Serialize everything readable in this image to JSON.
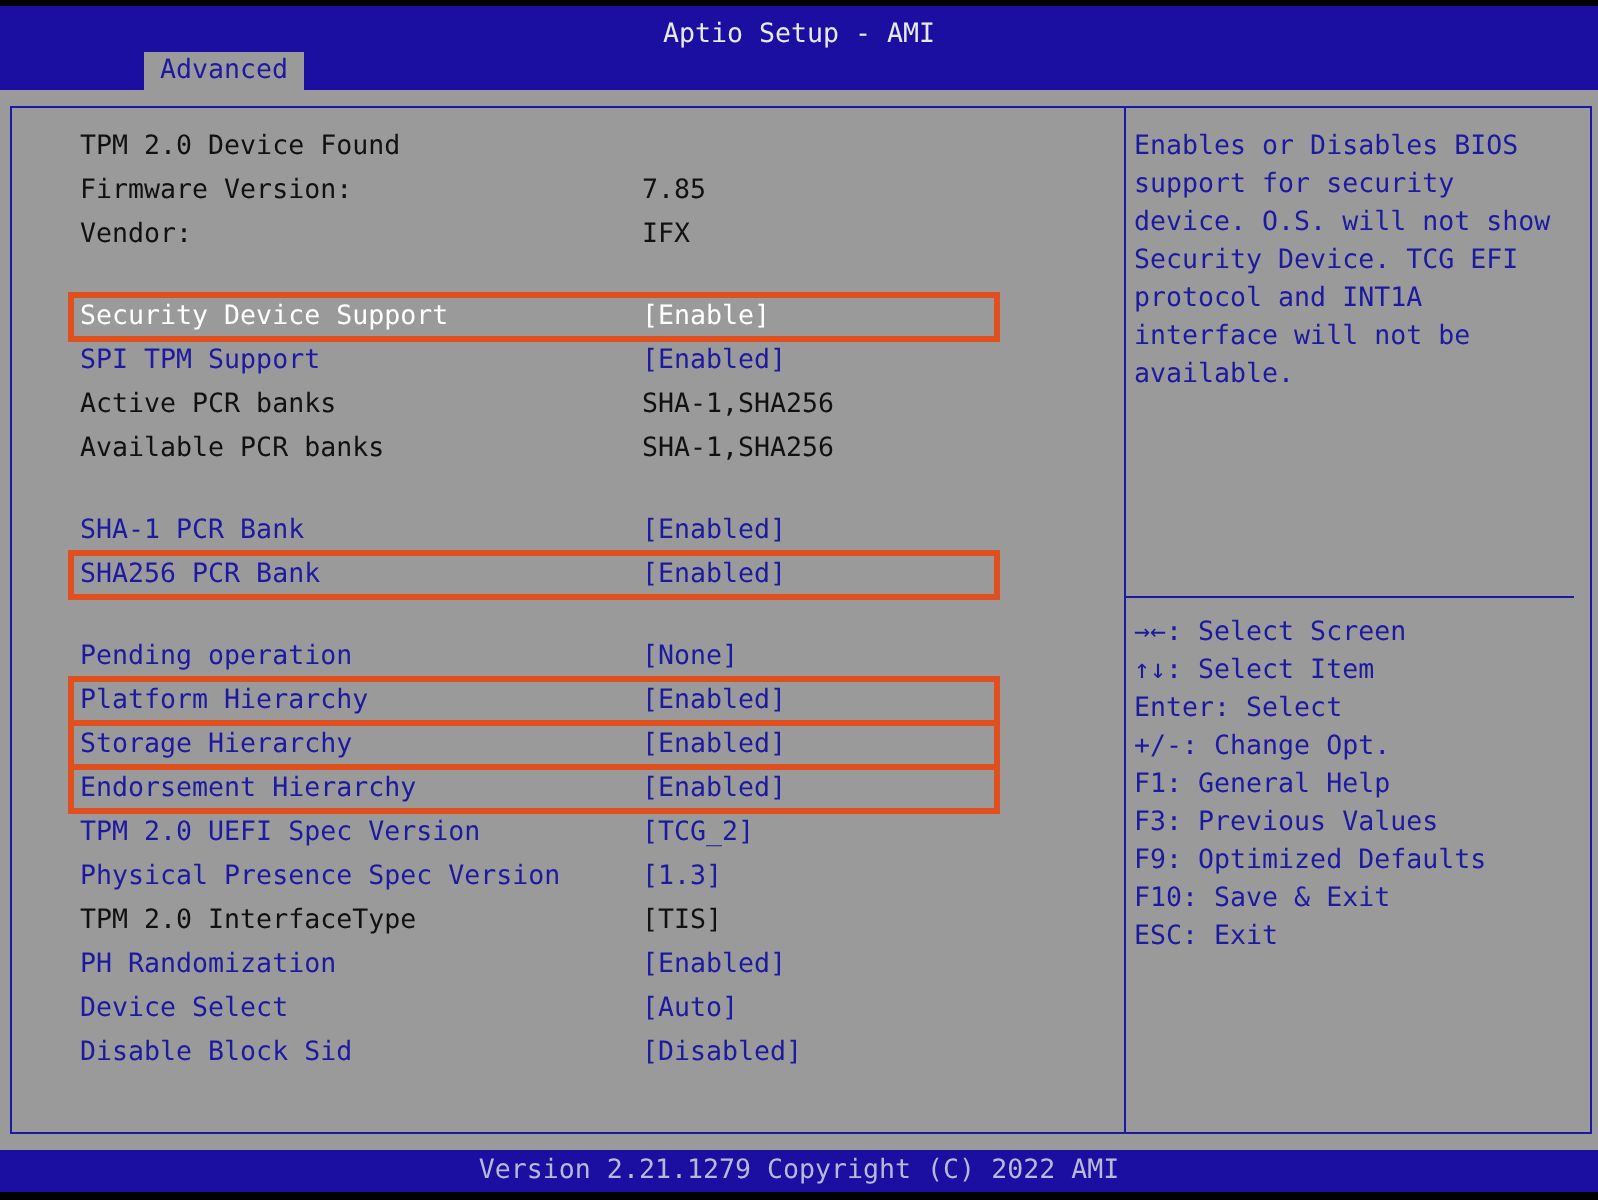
{
  "window": {
    "title": "Aptio Setup - AMI"
  },
  "tabs": [
    {
      "label": "Advanced",
      "selected": true
    }
  ],
  "sections": [
    {
      "rows": [
        {
          "kind": "info",
          "label": "TPM 2.0 Device Found"
        },
        {
          "kind": "info",
          "label": "Firmware Version:",
          "value": "7.85"
        },
        {
          "kind": "info",
          "label": "Vendor:",
          "value": "IFX"
        }
      ]
    },
    {
      "rows": [
        {
          "kind": "option",
          "label": "Security Device Support",
          "value": "[Enable]",
          "selected": true,
          "highlighted": true
        },
        {
          "kind": "option",
          "label": "SPI TPM Support",
          "value": "[Enabled]",
          "selected": false,
          "highlighted": false
        },
        {
          "kind": "info",
          "label": "Active PCR banks",
          "value": "SHA-1,SHA256"
        },
        {
          "kind": "info",
          "label": "Available PCR banks",
          "value": "SHA-1,SHA256"
        }
      ]
    },
    {
      "rows": [
        {
          "kind": "option",
          "label": "SHA-1 PCR Bank",
          "value": "[Enabled]",
          "selected": false,
          "highlighted": false
        },
        {
          "kind": "option",
          "label": "SHA256 PCR Bank",
          "value": "[Enabled]",
          "selected": false,
          "highlighted": true
        }
      ]
    },
    {
      "rows": [
        {
          "kind": "option",
          "label": "Pending operation",
          "value": "[None]",
          "selected": false,
          "highlighted": false
        },
        {
          "kind": "option",
          "label": "Platform Hierarchy",
          "value": "[Enabled]",
          "selected": false,
          "highlighted": true
        },
        {
          "kind": "option",
          "label": "Storage Hierarchy",
          "value": "[Enabled]",
          "selected": false,
          "highlighted": true
        },
        {
          "kind": "option",
          "label": "Endorsement Hierarchy",
          "value": "[Enabled]",
          "selected": false,
          "highlighted": true
        },
        {
          "kind": "option",
          "label": "TPM 2.0 UEFI Spec Version",
          "value": "[TCG_2]",
          "selected": false,
          "highlighted": false
        },
        {
          "kind": "option",
          "label": "Physical Presence Spec Version",
          "value": "[1.3]",
          "selected": false,
          "highlighted": false
        },
        {
          "kind": "info",
          "label": "TPM 2.0 InterfaceType",
          "value": "[TIS]"
        },
        {
          "kind": "option",
          "label": "PH Randomization",
          "value": "[Enabled]",
          "selected": false,
          "highlighted": false
        },
        {
          "kind": "option",
          "label": "Device Select",
          "value": "[Auto]",
          "selected": false,
          "highlighted": false
        },
        {
          "kind": "option",
          "label": "Disable Block Sid",
          "value": "[Disabled]",
          "selected": false,
          "highlighted": false
        }
      ]
    }
  ],
  "help": "Enables or Disables BIOS support for security device. O.S. will not show Security Device. TCG EFI protocol and INT1A interface will not be available.",
  "keys": [
    "→←: Select Screen",
    "↑↓: Select Item",
    "Enter: Select",
    "+/-: Change Opt.",
    "F1: General Help",
    "F3: Previous Values",
    "F9: Optimized Defaults",
    "F10: Save & Exit",
    "ESC: Exit"
  ],
  "footer": "Version 2.21.1279 Copyright (C) 2022 AMI"
}
